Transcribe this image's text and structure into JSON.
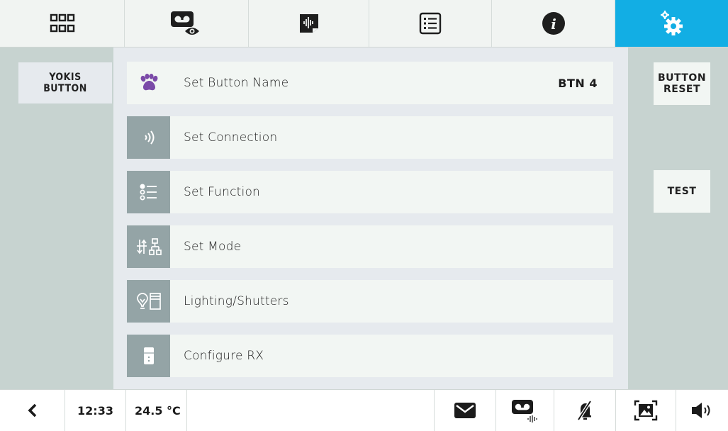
{
  "topbar": {
    "tabs": [
      {
        "icon": "apps-grid-icon"
      },
      {
        "icon": "video-memory-view-icon"
      },
      {
        "icon": "voice-memo-icon"
      },
      {
        "icon": "list-icon"
      },
      {
        "icon": "info-icon"
      },
      {
        "icon": "settings-gear-icon",
        "active": true
      }
    ]
  },
  "sidebar": {
    "left_tab_label": "YOKIS\nBUTTON"
  },
  "menu": {
    "items": [
      {
        "label": "Set Button Name",
        "value": "BTN 4",
        "icon": "paw-icon"
      },
      {
        "label": "Set Connection",
        "icon": "wireless-connection-icon"
      },
      {
        "label": "Set Function",
        "icon": "function-list-icon"
      },
      {
        "label": "Set Mode",
        "icon": "mode-icon"
      },
      {
        "label": "Lighting/Shutters",
        "icon": "lighting-shutters-icon"
      },
      {
        "label": "Configure RX",
        "icon": "receiver-icon"
      }
    ]
  },
  "right_panel": {
    "reset_label": "BUTTON\nRESET",
    "test_label": "TEST"
  },
  "statusbar": {
    "time": "12:33",
    "temperature": "24.5 °C"
  },
  "colors": {
    "accent": "#12aee4",
    "icon_tile": "#94a4a6",
    "paw": "#7b4aa8",
    "panel": "#c7d3d0"
  }
}
